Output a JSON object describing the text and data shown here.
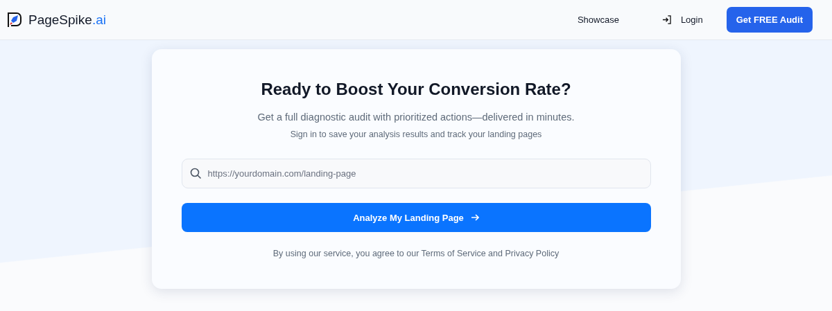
{
  "header": {
    "brand": {
      "name": "PageSpike",
      "suffix": ".ai"
    },
    "nav": [
      {
        "kind": "link",
        "label": "Showcase"
      },
      {
        "kind": "icon-link",
        "label": "Login"
      },
      {
        "kind": "primary",
        "label": "Get FREE Audit"
      }
    ]
  },
  "card": {
    "title": "Ready to Boost Your Conversion Rate?",
    "subtitle": "Get a full diagnostic audit with prioritized actions—delivered in minutes.",
    "note": "Sign in to save your analysis results and track your landing pages",
    "url_field": {
      "placeholder": "https://yourdomain.com/landing-page"
    },
    "submit": {
      "label": "Analyze My Landing Page"
    },
    "footer": "By using our service, you agree to our Terms of Service and Privacy Policy"
  }
}
